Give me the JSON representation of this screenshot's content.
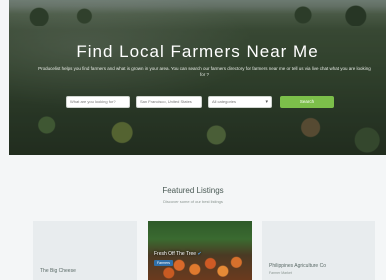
{
  "hero": {
    "title": "Find Local Farmers Near Me",
    "description": "Producelist helps you find farmers and what is grown in your area. You can search our farmers directory for farmers near me or tell us via live chat what you are looking for ?"
  },
  "search": {
    "what_placeholder": "What are you looking for?",
    "location_value": "San Francisco, United States",
    "category_value": "All categories",
    "button_label": "Search"
  },
  "featured": {
    "title": "Featured Listings",
    "subtitle": "Discover some of our best listings",
    "cards": [
      {
        "name": "The Big Cheese"
      },
      {
        "name": "Fresh Off The Tree",
        "badge": "Farmers"
      },
      {
        "name": "Philippines Agriculture Co",
        "subtitle": "Farmer Market"
      }
    ]
  }
}
